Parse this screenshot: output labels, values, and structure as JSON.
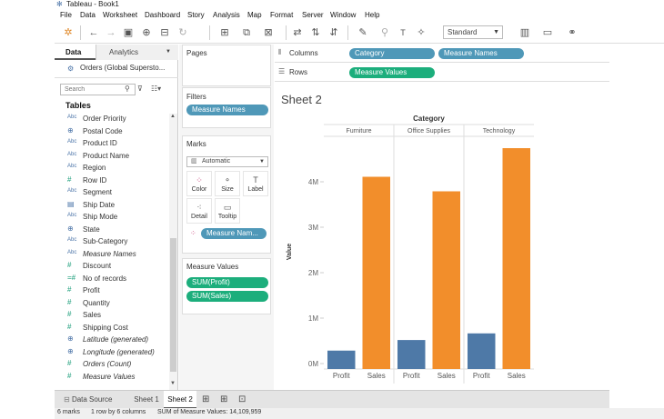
{
  "window": {
    "title": "Tableau - Book1"
  },
  "menu": [
    "File",
    "Data",
    "Worksheet",
    "Dashboard",
    "Story",
    "Analysis",
    "Map",
    "Format",
    "Server",
    "Window",
    "Help"
  ],
  "toolbar": {
    "fit_select": "Standard"
  },
  "left_pane": {
    "tab_data": "Data",
    "tab_analytics": "Analytics",
    "datasource": "Orders (Global Supersto...",
    "search_placeholder": "Search",
    "tables_heading": "Tables",
    "fields": [
      {
        "type": "Abc",
        "name": "Order Priority",
        "italic": false
      },
      {
        "type": "geo",
        "name": "Postal Code",
        "italic": false
      },
      {
        "type": "Abc",
        "name": "Product ID",
        "italic": false
      },
      {
        "type": "Abc",
        "name": "Product Name",
        "italic": false
      },
      {
        "type": "Abc",
        "name": "Region",
        "italic": false
      },
      {
        "type": "#",
        "name": "Row ID",
        "italic": false
      },
      {
        "type": "Abc",
        "name": "Segment",
        "italic": false
      },
      {
        "type": "date",
        "name": "Ship Date",
        "italic": false
      },
      {
        "type": "Abc",
        "name": "Ship Mode",
        "italic": false
      },
      {
        "type": "geo",
        "name": "State",
        "italic": false
      },
      {
        "type": "Abc",
        "name": "Sub-Category",
        "italic": false
      },
      {
        "type": "Abc",
        "name": "Measure Names",
        "italic": true
      },
      {
        "type": "#",
        "name": "Discount",
        "italic": false
      },
      {
        "type": "=#",
        "name": "No of records",
        "italic": false
      },
      {
        "type": "#",
        "name": "Profit",
        "italic": false
      },
      {
        "type": "#",
        "name": "Quantity",
        "italic": false
      },
      {
        "type": "#",
        "name": "Sales",
        "italic": false
      },
      {
        "type": "#",
        "name": "Shipping Cost",
        "italic": false
      },
      {
        "type": "geo",
        "name": "Latitude (generated)",
        "italic": true
      },
      {
        "type": "geo",
        "name": "Longitude (generated)",
        "italic": true
      },
      {
        "type": "#",
        "name": "Orders (Count)",
        "italic": true
      },
      {
        "type": "#",
        "name": "Measure Values",
        "italic": true
      }
    ]
  },
  "cards": {
    "pages_title": "Pages",
    "filters_title": "Filters",
    "filters_pill": "Measure Names",
    "marks_title": "Marks",
    "marks_type": "Automatic",
    "marks_buttons": [
      "Color",
      "Size",
      "Label",
      "Detail",
      "Tooltip"
    ],
    "marks_pill": "Measure Nam...",
    "measure_values_title": "Measure Values",
    "measure_values_pills": [
      "SUM(Profit)",
      "SUM(Sales)"
    ]
  },
  "shelves": {
    "columns_label": "Columns",
    "columns_pills": [
      "Category",
      "Measure Names"
    ],
    "rows_label": "Rows",
    "rows_pills": [
      "Measure Values"
    ]
  },
  "sheet": {
    "title": "Sheet 2"
  },
  "colors": {
    "profit": "#4e79a7",
    "sales": "#f28e2b",
    "blue_pill": "#4f98b8",
    "green_pill": "#1cae7c"
  },
  "chart_data": {
    "type": "bar",
    "header": "Category",
    "ylabel": "Value",
    "ylim": [
      0,
      4800000
    ],
    "y_ticks": [
      {
        "value": 0,
        "label": "0M"
      },
      {
        "value": 1000000,
        "label": "1M"
      },
      {
        "value": 2000000,
        "label": "2M"
      },
      {
        "value": 3000000,
        "label": "3M"
      },
      {
        "value": 4000000,
        "label": "4M"
      }
    ],
    "categories": [
      {
        "name": "Furniture",
        "bars": [
          {
            "measure": "Profit",
            "value": 285000
          },
          {
            "measure": "Sales",
            "value": 4110000
          }
        ]
      },
      {
        "name": "Office Supplies",
        "bars": [
          {
            "measure": "Profit",
            "value": 518000
          },
          {
            "measure": "Sales",
            "value": 3790000
          }
        ]
      },
      {
        "name": "Technology",
        "bars": [
          {
            "measure": "Profit",
            "value": 664000
          },
          {
            "measure": "Sales",
            "value": 4740000
          }
        ]
      }
    ]
  },
  "bottom_tabs": {
    "data_source": "Data Source",
    "sheet1": "Sheet 1",
    "sheet2": "Sheet 2"
  },
  "status": {
    "marks": "6 marks",
    "dims": "1 row by 6 columns",
    "sum": "SUM of Measure Values: 14,109,959"
  }
}
